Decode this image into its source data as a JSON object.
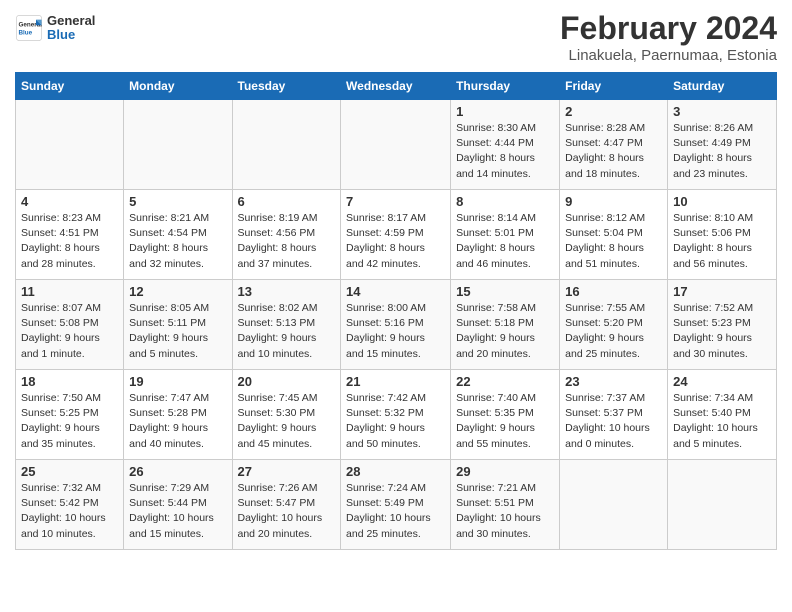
{
  "logo": {
    "general": "General",
    "blue": "Blue"
  },
  "title": "February 2024",
  "subtitle": "Linakuela, Paernumaa, Estonia",
  "weekdays": [
    "Sunday",
    "Monday",
    "Tuesday",
    "Wednesday",
    "Thursday",
    "Friday",
    "Saturday"
  ],
  "weeks": [
    [
      {
        "day": "",
        "info": ""
      },
      {
        "day": "",
        "info": ""
      },
      {
        "day": "",
        "info": ""
      },
      {
        "day": "",
        "info": ""
      },
      {
        "day": "1",
        "info": "Sunrise: 8:30 AM\nSunset: 4:44 PM\nDaylight: 8 hours and 14 minutes."
      },
      {
        "day": "2",
        "info": "Sunrise: 8:28 AM\nSunset: 4:47 PM\nDaylight: 8 hours and 18 minutes."
      },
      {
        "day": "3",
        "info": "Sunrise: 8:26 AM\nSunset: 4:49 PM\nDaylight: 8 hours and 23 minutes."
      }
    ],
    [
      {
        "day": "4",
        "info": "Sunrise: 8:23 AM\nSunset: 4:51 PM\nDaylight: 8 hours and 28 minutes."
      },
      {
        "day": "5",
        "info": "Sunrise: 8:21 AM\nSunset: 4:54 PM\nDaylight: 8 hours and 32 minutes."
      },
      {
        "day": "6",
        "info": "Sunrise: 8:19 AM\nSunset: 4:56 PM\nDaylight: 8 hours and 37 minutes."
      },
      {
        "day": "7",
        "info": "Sunrise: 8:17 AM\nSunset: 4:59 PM\nDaylight: 8 hours and 42 minutes."
      },
      {
        "day": "8",
        "info": "Sunrise: 8:14 AM\nSunset: 5:01 PM\nDaylight: 8 hours and 46 minutes."
      },
      {
        "day": "9",
        "info": "Sunrise: 8:12 AM\nSunset: 5:04 PM\nDaylight: 8 hours and 51 minutes."
      },
      {
        "day": "10",
        "info": "Sunrise: 8:10 AM\nSunset: 5:06 PM\nDaylight: 8 hours and 56 minutes."
      }
    ],
    [
      {
        "day": "11",
        "info": "Sunrise: 8:07 AM\nSunset: 5:08 PM\nDaylight: 9 hours and 1 minute."
      },
      {
        "day": "12",
        "info": "Sunrise: 8:05 AM\nSunset: 5:11 PM\nDaylight: 9 hours and 5 minutes."
      },
      {
        "day": "13",
        "info": "Sunrise: 8:02 AM\nSunset: 5:13 PM\nDaylight: 9 hours and 10 minutes."
      },
      {
        "day": "14",
        "info": "Sunrise: 8:00 AM\nSunset: 5:16 PM\nDaylight: 9 hours and 15 minutes."
      },
      {
        "day": "15",
        "info": "Sunrise: 7:58 AM\nSunset: 5:18 PM\nDaylight: 9 hours and 20 minutes."
      },
      {
        "day": "16",
        "info": "Sunrise: 7:55 AM\nSunset: 5:20 PM\nDaylight: 9 hours and 25 minutes."
      },
      {
        "day": "17",
        "info": "Sunrise: 7:52 AM\nSunset: 5:23 PM\nDaylight: 9 hours and 30 minutes."
      }
    ],
    [
      {
        "day": "18",
        "info": "Sunrise: 7:50 AM\nSunset: 5:25 PM\nDaylight: 9 hours and 35 minutes."
      },
      {
        "day": "19",
        "info": "Sunrise: 7:47 AM\nSunset: 5:28 PM\nDaylight: 9 hours and 40 minutes."
      },
      {
        "day": "20",
        "info": "Sunrise: 7:45 AM\nSunset: 5:30 PM\nDaylight: 9 hours and 45 minutes."
      },
      {
        "day": "21",
        "info": "Sunrise: 7:42 AM\nSunset: 5:32 PM\nDaylight: 9 hours and 50 minutes."
      },
      {
        "day": "22",
        "info": "Sunrise: 7:40 AM\nSunset: 5:35 PM\nDaylight: 9 hours and 55 minutes."
      },
      {
        "day": "23",
        "info": "Sunrise: 7:37 AM\nSunset: 5:37 PM\nDaylight: 10 hours and 0 minutes."
      },
      {
        "day": "24",
        "info": "Sunrise: 7:34 AM\nSunset: 5:40 PM\nDaylight: 10 hours and 5 minutes."
      }
    ],
    [
      {
        "day": "25",
        "info": "Sunrise: 7:32 AM\nSunset: 5:42 PM\nDaylight: 10 hours and 10 minutes."
      },
      {
        "day": "26",
        "info": "Sunrise: 7:29 AM\nSunset: 5:44 PM\nDaylight: 10 hours and 15 minutes."
      },
      {
        "day": "27",
        "info": "Sunrise: 7:26 AM\nSunset: 5:47 PM\nDaylight: 10 hours and 20 minutes."
      },
      {
        "day": "28",
        "info": "Sunrise: 7:24 AM\nSunset: 5:49 PM\nDaylight: 10 hours and 25 minutes."
      },
      {
        "day": "29",
        "info": "Sunrise: 7:21 AM\nSunset: 5:51 PM\nDaylight: 10 hours and 30 minutes."
      },
      {
        "day": "",
        "info": ""
      },
      {
        "day": "",
        "info": ""
      }
    ]
  ]
}
